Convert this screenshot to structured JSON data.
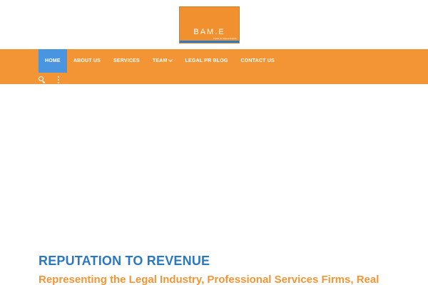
{
  "logo": {
    "text": "BAM.E",
    "subtext": "PUBLIC RELATIONS",
    "bg_color": "#f0902f",
    "bar_color": "#2f7cc4"
  },
  "nav": {
    "items": [
      {
        "label": "HOME",
        "active": true
      },
      {
        "label": "ABOUT US"
      },
      {
        "label": "SERVICES"
      },
      {
        "label": "TEAM",
        "has_dropdown": true
      },
      {
        "label": "LEGAL PR BLOG"
      },
      {
        "label": "CONTACT US"
      }
    ],
    "tools": [
      "search-icon",
      "more-vertical-icon"
    ],
    "bg_color": "#f39535",
    "active_color": "#4a95e0"
  },
  "hero": {
    "heading": "REPUTATION TO REVENUE",
    "subheading": "Representing the Legal Industry, Professional Services Firms, Real",
    "heading_color": "#2a78c2",
    "subheading_color": "#f39535"
  }
}
